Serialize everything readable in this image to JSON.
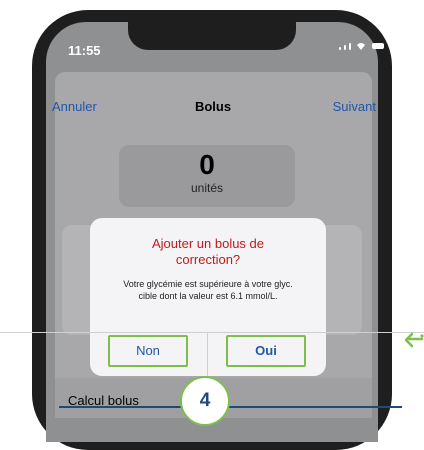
{
  "status": {
    "time": "11:55"
  },
  "nav": {
    "cancel": "Annuler",
    "title": "Bolus",
    "next": "Suivant"
  },
  "units": {
    "value": "0",
    "label": "unités"
  },
  "alert": {
    "title": "Ajouter un bolus de correction?",
    "message": "Votre glycémie est supérieure à votre glyc. cible dont la valeur est 6.1 mmol/L.",
    "no": "Non",
    "yes": "Oui"
  },
  "list": {
    "calc": "Calcul bolus"
  },
  "step": {
    "number": "4"
  },
  "colors": {
    "accent_green": "#7dbf4a",
    "link_blue": "#1e57a8",
    "alert_red": "#c11a1a",
    "step_blue": "#1d4a7a"
  },
  "icons": {
    "pointer": "arrow-left-icon"
  }
}
